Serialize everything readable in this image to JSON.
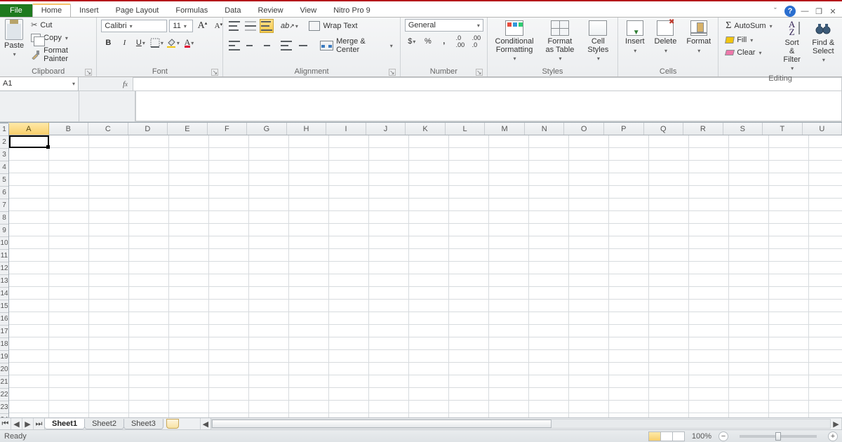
{
  "tabs": {
    "file": "File",
    "items": [
      "Home",
      "Insert",
      "Page Layout",
      "Formulas",
      "Data",
      "Review",
      "View",
      "Nitro Pro 9"
    ],
    "active": "Home"
  },
  "ribbon": {
    "clipboard": {
      "paste": "Paste",
      "cut": "Cut",
      "copy": "Copy",
      "format_painter": "Format Painter",
      "label": "Clipboard"
    },
    "font": {
      "name": "Calibri",
      "size": "11",
      "bold": "B",
      "italic": "I",
      "underline": "U",
      "label": "Font"
    },
    "alignment": {
      "wrap": "Wrap Text",
      "merge": "Merge & Center",
      "label": "Alignment"
    },
    "number": {
      "format": "General",
      "label": "Number"
    },
    "styles": {
      "cond": "Conditional Formatting",
      "table": "Format as Table",
      "cell": "Cell Styles",
      "label": "Styles"
    },
    "cells": {
      "insert": "Insert",
      "delete": "Delete",
      "format": "Format",
      "label": "Cells"
    },
    "editing": {
      "autosum": "AutoSum",
      "fill": "Fill",
      "clear": "Clear",
      "sort": "Sort & Filter",
      "find": "Find & Select",
      "label": "Editing"
    }
  },
  "namebox": {
    "value": "A1"
  },
  "columns": [
    "A",
    "B",
    "C",
    "D",
    "E",
    "F",
    "G",
    "H",
    "I",
    "J",
    "K",
    "L",
    "M",
    "N",
    "O",
    "P",
    "Q",
    "R",
    "S",
    "T",
    "U"
  ],
  "active_column": "A",
  "active_cell": "A1",
  "sheets": {
    "items": [
      "Sheet1",
      "Sheet2",
      "Sheet3"
    ],
    "active": "Sheet1"
  },
  "status": {
    "ready": "Ready",
    "zoom": "100%"
  }
}
